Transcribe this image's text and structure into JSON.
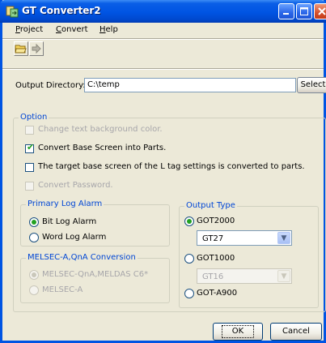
{
  "window": {
    "title": "GT Converter2"
  },
  "menu": [
    {
      "key": "P",
      "rest": "roject"
    },
    {
      "key": "C",
      "rest": "onvert"
    },
    {
      "key": "H",
      "rest": "elp"
    }
  ],
  "toolbar": {
    "open_icon": "folder-open-icon",
    "convert_icon": "arrow-right-icon"
  },
  "output": {
    "label": "Output Directory:",
    "value": "C:\\temp",
    "select_label": "Select"
  },
  "option": {
    "legend": "Option",
    "checkboxes": [
      {
        "label": "Change text background color.",
        "checked": false,
        "enabled": false
      },
      {
        "label": "Convert Base Screen into Parts.",
        "checked": true,
        "enabled": true
      },
      {
        "label": "The target base screen of the L tag settings is converted to parts.",
        "checked": false,
        "enabled": true
      },
      {
        "label": "Convert Password.",
        "checked": false,
        "enabled": false
      }
    ]
  },
  "primary_log_alarm": {
    "legend": "Primary Log Alarm",
    "options": [
      {
        "label": "Bit Log Alarm",
        "selected": true
      },
      {
        "label": "Word Log Alarm",
        "selected": false
      }
    ]
  },
  "melsec": {
    "legend": "MELSEC-A,QnA Conversion",
    "options": [
      {
        "label": "MELSEC-QnA,MELDAS C6*",
        "selected": true,
        "enabled": false
      },
      {
        "label": "MELSEC-A",
        "selected": false,
        "enabled": false
      }
    ]
  },
  "output_type": {
    "legend": "Output Type",
    "got2000": {
      "label": "GOT2000",
      "selected": true,
      "model": "GT27"
    },
    "got1000": {
      "label": "GOT1000",
      "selected": false,
      "model": "GT16"
    },
    "gota900": {
      "label": "GOT-A900",
      "selected": false
    }
  },
  "buttons": {
    "ok": "OK",
    "cancel": "Cancel"
  },
  "colors": {
    "titlebar": "#0054e3",
    "face": "#ece9d8",
    "legend": "#0046d5",
    "check": "#21a121"
  }
}
